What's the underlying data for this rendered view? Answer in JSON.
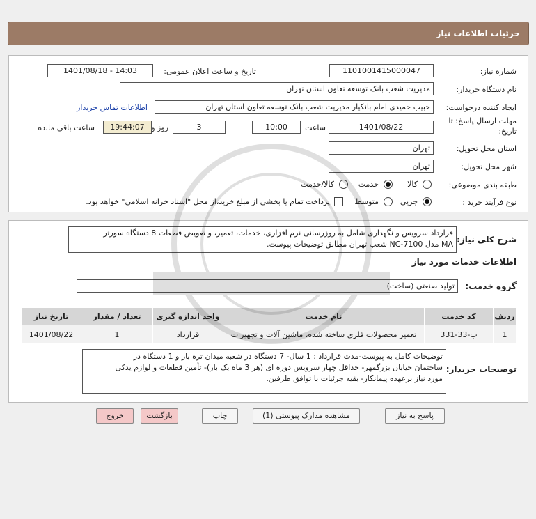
{
  "header": {
    "title": "جزئیات اطلاعات نیاز"
  },
  "form": {
    "need_number_label": "شماره نیاز:",
    "need_number": "1101001415000047",
    "announce_label": "تاریخ و ساعت اعلان عمومی:",
    "announce_value": "1401/08/18 - 14:03",
    "buyer_org_label": "نام دستگاه خریدار:",
    "buyer_org": "مدیریت شعب بانک توسعه تعاون استان تهران",
    "requester_label": "ایجاد کننده درخواست:",
    "requester": "حبیب حمیدی امام بانکیار مدیریت شعب بانک توسعه تعاون استان تهران",
    "contact_link": "اطلاعات تماس خریدار",
    "deadline_label_1": "مهلت ارسال پاسخ: تا",
    "deadline_label_2": "تاریخ:",
    "deadline_date": "1401/08/22",
    "time_label": "ساعت",
    "deadline_time": "10:00",
    "days": "3",
    "days_label": "روز و",
    "remaining_time": "19:44:07",
    "remaining_label": "ساعت باقی مانده",
    "province_label": "استان محل تحویل:",
    "province": "تهران",
    "city_label": "شهر محل تحویل:",
    "city": "تهران",
    "category_label": "طبقه بندی موضوعی:",
    "category_options": [
      "کالا",
      "خدمت",
      "کالا/خدمت"
    ],
    "process_label": "نوع فرآیند خرید :",
    "process_options": [
      "جزیی",
      "متوسط"
    ],
    "payment_note": "پرداخت تمام یا بخشی از مبلغ خرید،از محل \"اسناد خزانه اسلامی\" خواهد بود."
  },
  "summary": {
    "label": "شرح کلی نیاز:",
    "text_line1": "قرارداد سرویس و نگهداری شامل به روزرسانی نرم افزاری، خدمات، تعمیر، و تعویض قطعات 8 دستگاه سورتر",
    "text_line2": "MA مدل NC-7100 شعب تهران مطابق توضیحات پیوست."
  },
  "services": {
    "section_title": "اطلاعات خدمات مورد نیاز",
    "group_label": "گروه خدمت:",
    "group_value": "تولید صنعتی (ساخت)",
    "columns": [
      "ردیف",
      "کد خدمت",
      "نام خدمت",
      "واحد اندازه گیری",
      "تعداد / مقدار",
      "تاریخ نیاز"
    ],
    "rows": [
      [
        "1",
        "ب-33-331",
        "تعمیر محصولات فلزی ساخته شده، ماشین آلات و تجهیزات",
        "قرارداد",
        "1",
        "1401/08/22"
      ]
    ]
  },
  "buyer_notes": {
    "label": "توضیحات خریدار:",
    "line1": "توضیحات کامل به پیوست-مدت قرارداد : 1 سال- 7 دستگاه در شعبه میدان تره بار و 1 دستگاه در",
    "line2": "ساختمان خیابان بزرگمهر- حداقل چهار سرویس دوره ای (هر 3 ماه یک بار)- تأمین قطعات و لوازم یدکی",
    "line3": "مورد نیاز برعهده پیمانکار- بقیه جزئیات با توافق طرفین."
  },
  "buttons": {
    "reply": "پاسخ به نیاز",
    "attachments": "مشاهده مدارک پیوستی (1)",
    "print": "چاپ",
    "back": "بازگشت",
    "exit": "خروج"
  }
}
